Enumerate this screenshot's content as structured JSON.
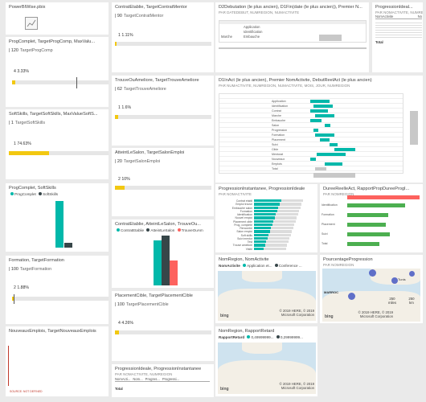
{
  "tiles": {
    "powerbi": {
      "title": "PowerBIWise.pbix"
    },
    "progcomplet": {
      "title": "ProgComplet, TargetProgComp, MaxValu...",
      "kpi_value": "120",
      "kpi_label": "TargetProgComp",
      "pct": "4  3.33%",
      "progress": 0.0333
    },
    "softskills": {
      "title": "SoftSkills, TargetSoftSkills, MaxValueSoftS...",
      "kpi_value": "1",
      "kpi_label": "TargetSoftSkills",
      "pct": "1  74.63%",
      "progress": 0.7463
    },
    "progsoft": {
      "title": "ProgComplet, SoftSkills",
      "legend": [
        "ProgComplet",
        "SoftSkills"
      ],
      "colors": {
        "ProgComplet": "#01b8aa",
        "SoftSkills": "#374649"
      }
    },
    "formation": {
      "title": "Formation, TargetFormation",
      "kpi_value": "100",
      "kpi_label": "TargetFormation",
      "pct": "2  1.88%",
      "progress": 0.0188
    },
    "nouveaux": {
      "title": "NouveauxEmplois, TargetNouveauxEmplois",
      "footnote": "SOURCE: NOT DEFINED"
    },
    "contrat": {
      "title": "ContratEtablie, TargetContratMentor",
      "kpi_value": "90",
      "kpi_label": "TargetContratMentor",
      "pct": "1  1.11%",
      "progress": 0.0111
    },
    "trouve": {
      "title": "TrouveOuAmeliore, TargetTrouveAmeliore",
      "kpi_value": "62",
      "kpi_label": "TargetTrouveAmeliore",
      "pct": "1  1.6%",
      "progress": 0.016
    },
    "atteint": {
      "title": "AtteintLeSalon, TargetSalonEmploi",
      "kpi_value": "20",
      "kpi_label": "TargetSalonEmploi",
      "pct": "2  10%",
      "progress": 0.1
    },
    "contratcol": {
      "title": "ContratEtablie, AtteintLeSalon, TrouveOu...",
      "legend": [
        "ContratEtablie",
        "AtteintLeSalon",
        "TrouveOuAm"
      ],
      "colors": {
        "ContratEtablie": "#01b8aa",
        "AtteintLeSalon": "#374649",
        "TrouveOuAm": "#fd625e"
      }
    },
    "placement": {
      "title": "PlacementCible, TargetPlacementCible",
      "kpi_value": "100",
      "kpi_label": "TargetPlacementCible",
      "pct": "4  4.26%",
      "progress": 0.0426
    },
    "progressiondeale": {
      "title": "ProgressionIdeale, ProgressionInstantanee",
      "subtitle": "PAR NOMACTIVITE, NUMREGION",
      "headers": [
        "NomActi...",
        "Nom...",
        "Progres...",
        "Progressi..."
      ],
      "total": "Total"
    },
    "d2debut": {
      "title": "D2Debutation (le plus ancien), D1Fin(date (le plus ancien)), Premier N...",
      "subtitle": "PAR DATEDEBUT, NUMREGION, NUMACTIVITE",
      "rows": [
        "Application",
        "Identification",
        "Marche",
        "Embauche"
      ]
    },
    "progideal2": {
      "title": "ProgressionIdeal...",
      "subtitle": "PAR NOMACTIVITE, NUMREG...",
      "col1": "NomActivite",
      "col2": "No",
      "total": "Total"
    },
    "gantt": {
      "title": "D1InAct (le plus ancien), Premier NomActivite, DebutReelAct (le plus ancien)",
      "subtitle": "PAR NUMACTIVITE, NUMREGION, NUMACTIVITE, MOIS, JOUR, NUMREGION",
      "tasks": [
        "Application",
        "Identification",
        "Contrat",
        "Marche",
        "Embauche",
        "Salon",
        "Progression",
        "Formation",
        "Placement",
        "Suivi",
        "Cible",
        "Mentorat",
        "Nouveaux",
        "Emplois",
        "Total"
      ]
    },
    "progbars": {
      "title": "ProgressionInstantanee, ProgressionIdeale",
      "subtitle": "PAR NOMACTIVITE",
      "labels": [
        "Contrat etabli",
        "Emploi trouve",
        "Embauche salon",
        "Formation",
        "Identification",
        "Nouvel emploi",
        "Placement cible",
        "Prog. complete",
        "Rencontre",
        "Salon emploi",
        "Soft skills",
        "Suivi mentor",
        "Test",
        "Trouve ameliore",
        "Visite"
      ],
      "ideal": [
        0.8,
        0.78,
        0.76,
        0.74,
        0.72,
        0.7,
        0.68,
        0.66,
        0.64,
        0.62,
        0.6,
        0.58,
        0.56,
        0.54,
        0.52
      ],
      "instant": [
        0.45,
        0.42,
        0.4,
        0.38,
        0.36,
        0.34,
        0.32,
        0.3,
        0.28,
        0.26,
        0.24,
        0.22,
        0.2,
        0.18,
        0.16
      ]
    },
    "duree": {
      "title": "DureeReelleAct, RapportPropDureeProgI...",
      "subtitle": "PAR NOMREGION",
      "labels": [
        "Identification",
        "Formation",
        "Placement",
        "Suivi",
        "Total"
      ],
      "values": [
        0.82,
        0.58,
        0.55,
        0.6,
        0.45
      ]
    },
    "nomregion": {
      "title": "NomRegion, NomActivite",
      "legend_title": "NomActivite",
      "legend": [
        "Application et...",
        "Conference ..."
      ],
      "brand": "bing",
      "copyright": "© 2019 HERE, © 2019 Microsoft Corporation"
    },
    "pourcentage": {
      "title": "PourcentageProgression",
      "subtitle": "PAR NOMREGION",
      "city1": "Tunis",
      "city2": "MARROC",
      "scale1": "250 miles",
      "scale2": "250 km",
      "brand": "bing",
      "copyright": "© 2019 HERE, © 2019 Microsoft Corporation"
    },
    "rapport": {
      "title": "NomRegion, RapportRetard",
      "legend_title": "RapportRetard",
      "legend": [
        "0,49999999...",
        "0,29999999..."
      ],
      "brand": "bing",
      "copyright": "© 2019 HERE, © 2019 Microsoft Corporation"
    }
  }
}
